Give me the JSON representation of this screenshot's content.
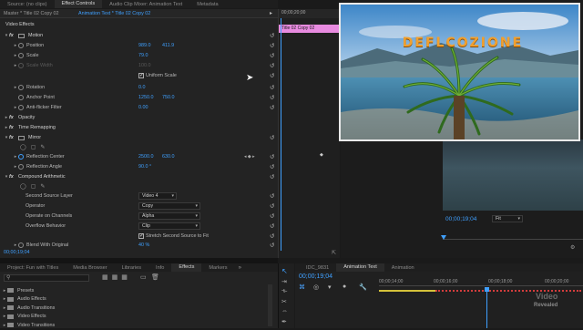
{
  "source_tabs": [
    "Source: (no clips)",
    "Effect Controls",
    "Audio Clip Mixer: Animation Text",
    "Metadata"
  ],
  "ec_header": {
    "master": "Master * Title 02 Copy 02",
    "seq": "Animation Text * Title 02 Copy 02",
    "ruler_time": "00;00;20;00",
    "clip_label": "Title 02 Copy 02"
  },
  "video_effects_label": "Video Effects",
  "motion": {
    "label": "Motion",
    "position": {
      "label": "Position",
      "x": "989.0",
      "y": "411.9"
    },
    "scale": {
      "label": "Scale",
      "value": "79.0"
    },
    "scale_width": {
      "label": "Scale Width",
      "value": "100.0"
    },
    "uniform_scale": "Uniform Scale",
    "rotation": {
      "label": "Rotation",
      "value": "0.0"
    },
    "anchor": {
      "label": "Anchor Point",
      "x": "1250.0",
      "y": "750.0"
    },
    "antiflicker": {
      "label": "Anti-flicker Filter",
      "value": "0.00"
    }
  },
  "opacity_label": "Opacity",
  "time_remap_label": "Time Remapping",
  "mirror": {
    "label": "Mirror",
    "center": {
      "label": "Reflection Center",
      "x": "2500.0",
      "y": "630.0"
    },
    "angle": {
      "label": "Reflection Angle",
      "value": "90.0 °"
    }
  },
  "compound": {
    "label": "Compound Arithmetic",
    "second_layer": {
      "label": "Second Source Layer",
      "value": "Video 4"
    },
    "operator": {
      "label": "Operator",
      "value": "Copy"
    },
    "channels": {
      "label": "Operate on Channels",
      "value": "Alpha"
    },
    "overflow": {
      "label": "Overflow Behavior",
      "value": "Clip"
    },
    "stretch": "Stretch Second Source to Fit",
    "blend": {
      "label": "Blend With Original",
      "value": "40 %"
    }
  },
  "ec_time": "00;00;19;04",
  "preview_text": "DEFLCOZIONE",
  "program": {
    "time": "00;00;19;04",
    "fit": "Fit"
  },
  "project_tabs": [
    "Project: Fun with Titles",
    "Media Browser",
    "Libraries",
    "Info",
    "Effects",
    "Markers"
  ],
  "effects_list": [
    "Presets",
    "Audio Effects",
    "Audio Transitions",
    "Video Effects",
    "Video Transitions"
  ],
  "timeline_tabs": [
    "IDC_9831",
    "Animation Text",
    "Animation"
  ],
  "timeline": {
    "time": "00;00;19;04",
    "ticks": [
      "00;00;14;00",
      "00;00;16;00",
      "00;00;18;00",
      "00;00;20;00"
    ]
  },
  "watermark": [
    "Video",
    "Revealed"
  ],
  "colors": {
    "accent": "#3fa0ff",
    "clip": "#e88be0",
    "title_orange": "#f0a030"
  }
}
